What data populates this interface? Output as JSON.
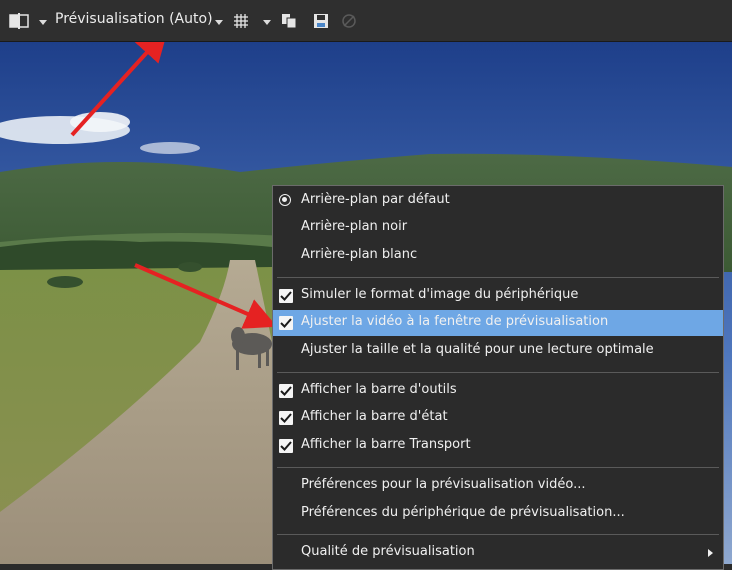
{
  "toolbar": {
    "title": "Prévisualisation (Auto)"
  },
  "icons": {
    "layout": "split-view-icon",
    "dropdown": "chevron-down-icon",
    "grid": "grid-icon",
    "copy": "copy-frame-icon",
    "save": "save-snapshot-icon",
    "external": "external-monitor-icon"
  },
  "menu": {
    "items": [
      {
        "label": "Arrière-plan par défaut",
        "mark": "radio"
      },
      {
        "label": "Arrière-plan noir",
        "mark": "none"
      },
      {
        "label": "Arrière-plan blanc",
        "mark": "none"
      },
      {
        "label": "Simuler le format d'image du périphérique",
        "mark": "check"
      },
      {
        "label": "Ajuster la vidéo à la fenêtre de prévisualisation",
        "mark": "check",
        "highlighted": true
      },
      {
        "label": "Ajuster la taille et la qualité pour une lecture optimale",
        "mark": "none"
      },
      {
        "label": "Afficher la barre d'outils",
        "mark": "check"
      },
      {
        "label": "Afficher la barre d'état",
        "mark": "check"
      },
      {
        "label": "Afficher la barre Transport",
        "mark": "check"
      },
      {
        "label": "Préférences pour la prévisualisation vidéo...",
        "mark": "none"
      },
      {
        "label": "Préférences du périphérique de prévisualisation...",
        "mark": "none"
      },
      {
        "label": "Qualité de prévisualisation",
        "mark": "submenu"
      }
    ]
  },
  "colors": {
    "highlight": "#6ea7e5",
    "annotation_arrow": "#e52222"
  }
}
